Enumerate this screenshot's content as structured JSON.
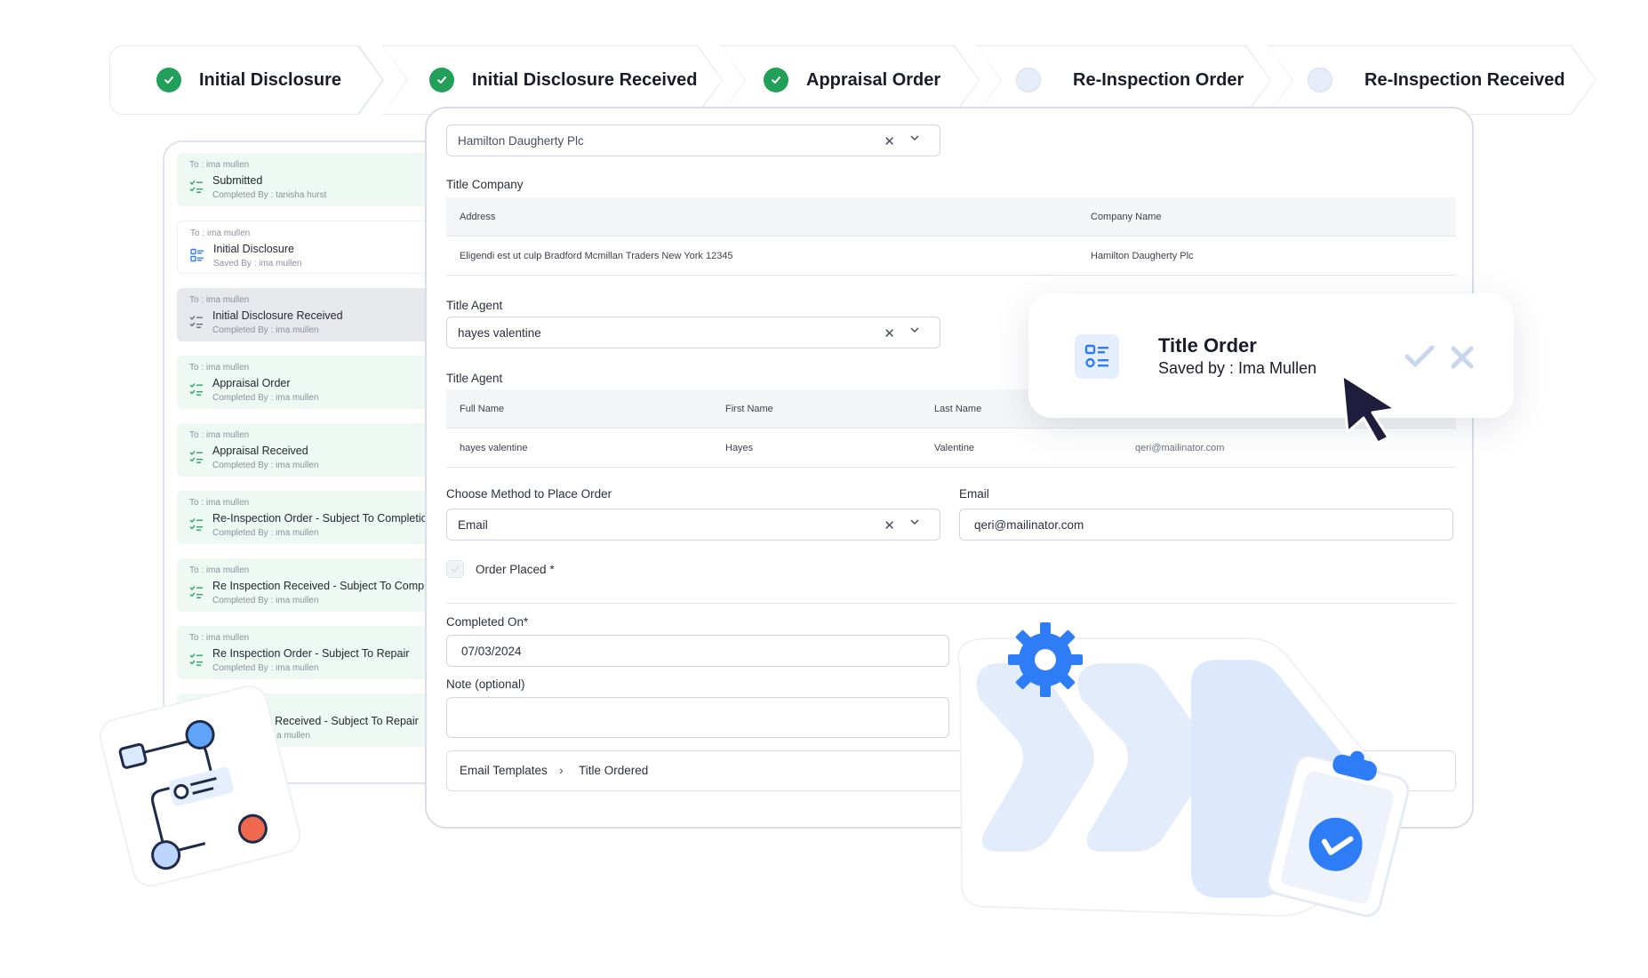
{
  "stepper": {
    "steps": [
      {
        "label": "Initial Disclosure",
        "status": "done"
      },
      {
        "label": "Initial Disclosure Received",
        "status": "done"
      },
      {
        "label": "Appraisal Order",
        "status": "done"
      },
      {
        "label": "Re-Inspection Order",
        "status": "pending"
      },
      {
        "label": "Re-Inspection Received",
        "status": "pending"
      }
    ]
  },
  "activity": {
    "items": [
      {
        "to": "To : ima mullen",
        "title": "Submitted",
        "by": "Completed By : tanisha hurst",
        "status": "completed"
      },
      {
        "to": "To : ima mullen",
        "title": "Initial Disclosure",
        "by": "Saved By : ima mullen",
        "status": "saved"
      },
      {
        "to": "To : ima mullen",
        "title": "Initial Disclosure Received",
        "by": "Completed By : ima mullen",
        "status": "active"
      },
      {
        "to": "To : ima mullen",
        "title": "Appraisal Order",
        "by": "Completed By : ima mullen",
        "status": "completed"
      },
      {
        "to": "To : ima mullen",
        "title": "Appraisal Received",
        "by": "Completed By : ima mullen",
        "status": "completed"
      },
      {
        "to": "To : ima mullen",
        "title": "Re-Inspection Order - Subject To Completio",
        "by": "Completed By : ima mullen",
        "status": "completed"
      },
      {
        "to": "To : ima mullen",
        "title": "Re Inspection Received - Subject To Comple",
        "by": "Completed By : ima mullen",
        "status": "completed"
      },
      {
        "to": "To : ima mullen",
        "title": "Re Inspection Order - Subject To Repair",
        "by": "Completed By : ima mullen",
        "status": "completed"
      },
      {
        "to": "",
        "title": "ion Received - Subject To Repair",
        "by": ": ima mullen",
        "status": "completed"
      }
    ]
  },
  "form": {
    "title_company_select": "Hamilton Daugherty Plc",
    "title_company_label": "Title Company",
    "company_table": {
      "headers": [
        "Address",
        "Company Name"
      ],
      "row": [
        "Eligendi est ut culp Bradford Mcmillan Traders New York 12345",
        "Hamilton Daugherty Plc"
      ]
    },
    "title_agent_label": "Title Agent",
    "title_agent_select": "hayes valentine",
    "agent_table_label": "Title Agent",
    "agent_table": {
      "headers": [
        "Full Name",
        "First Name",
        "Last Name"
      ],
      "row": [
        "hayes valentine",
        "Hayes",
        "Valentine",
        "qeri@mailinator.com"
      ]
    },
    "method_label": "Choose Method to Place Order",
    "method_value": "Email",
    "email_label": "Email",
    "email_value": "qeri@mailinator.com",
    "order_placed_label": "Order Placed",
    "required_mark": "*",
    "completed_on_label": "Completed On*",
    "completed_on_value": "07/03/2024",
    "note_label": "Note (optional)",
    "breadcrumb": [
      "Email Templates",
      "Title Ordered"
    ],
    "breadcrumb_sep": "›"
  },
  "popup": {
    "title": "Title Order",
    "subtitle": "Saved by : Ima Mullen"
  },
  "icons": {
    "clear": "close-icon",
    "dropdown": "chevron-down-icon",
    "check": "check-icon",
    "cursor": "cursor-arrow-icon"
  },
  "colors": {
    "done": "#22a05a",
    "pending": "#e6ecf8",
    "accent_blue": "#2f7df6",
    "list_completed_bg": "#eef9f3",
    "list_active_bg": "#e6e8ec",
    "coral": "#f0694f"
  }
}
